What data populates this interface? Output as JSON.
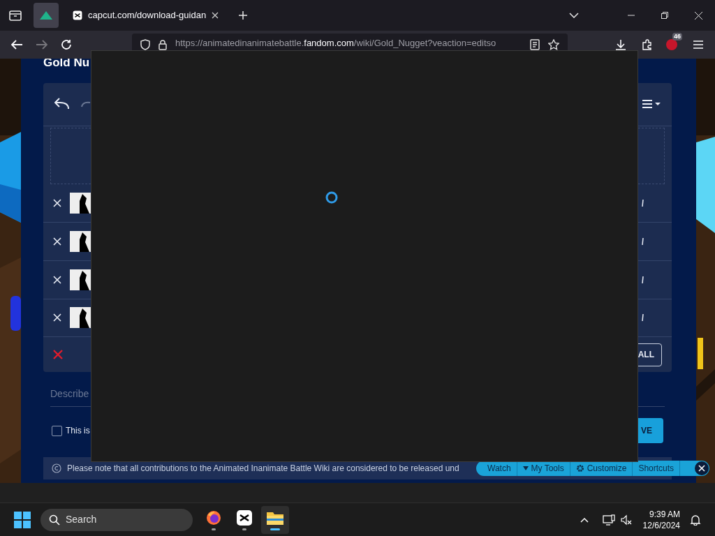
{
  "browser": {
    "tabs": [
      {
        "kind": "pinned",
        "selected": true
      },
      {
        "kind": "page",
        "title": "capcut.com/download-guidan",
        "selected": false
      }
    ],
    "url": {
      "prefix": "https://animatedinanimatebattle.",
      "domain": "fandom.com",
      "path": "/wiki/Gold_Nugget?veaction=editso"
    },
    "extension_badge": "46"
  },
  "editor": {
    "title": "Gold Nu",
    "summary": {
      "placeholder": "Describe"
    },
    "minor_edit": {
      "label": "This is",
      "checked": false
    },
    "remove_all_button": "ALL",
    "save_button": "VE"
  },
  "notice": "Please note that all contributions to the Animated Inanimate Battle Wiki are considered to be released und",
  "toolbar": [
    {
      "kind": "plain",
      "label": "Watch"
    },
    {
      "kind": "menu",
      "label": "My Tools"
    },
    {
      "kind": "gear",
      "label": "Customize"
    },
    {
      "kind": "plain",
      "label": "Shortcuts"
    }
  ],
  "dialog": {
    "loading": true
  },
  "taskbar": {
    "search_placeholder": "Search",
    "apps": [
      {
        "kind": "firefox",
        "selected": false
      },
      {
        "kind": "capcut",
        "selected": false
      },
      {
        "kind": "files",
        "selected": true
      }
    ],
    "time": "9:39 AM",
    "date": "12/6/2024"
  }
}
